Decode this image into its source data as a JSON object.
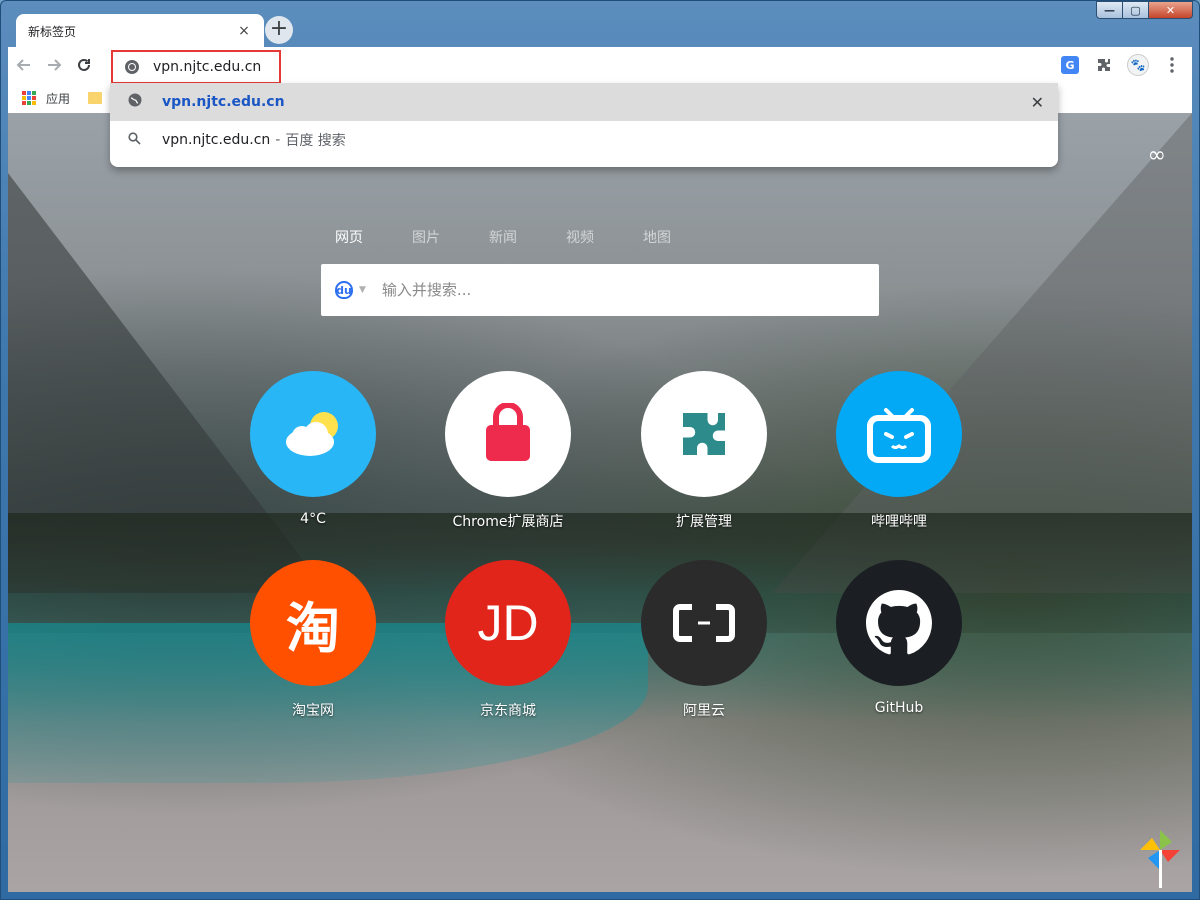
{
  "browser": {
    "tab_title": "新标签页",
    "tab_close": "×",
    "new_tab": "+",
    "omnibox_value": "vpn.njtc.edu.cn",
    "bookmarks": {
      "apps_label": "应用"
    }
  },
  "window_controls": {
    "minimize": "—",
    "maximize": "▢",
    "close": "✕"
  },
  "omnibox_dropdown": {
    "suggestions": [
      {
        "text": "vpn.njtc.edu.cn",
        "icon": "globe-icon"
      },
      {
        "text": "vpn.njtc.edu.cn",
        "separator": "-",
        "description": "百度 搜索",
        "icon": "search-icon"
      }
    ],
    "remove_glyph": "✕"
  },
  "newtab": {
    "search_tabs": [
      "网页",
      "图片",
      "新闻",
      "视频",
      "地图"
    ],
    "active_search_tab": "网页",
    "search_placeholder": "输入并搜索...",
    "engine_icon": "baidu-icon",
    "tiles": [
      {
        "label": "4°C",
        "icon": "weather-icon",
        "color": "#29b6f6"
      },
      {
        "label": "Chrome扩展商店",
        "icon": "bag-icon",
        "color": "#ffffff"
      },
      {
        "label": "扩展管理",
        "icon": "puzzle-icon",
        "color": "#ffffff"
      },
      {
        "label": "哔哩哔哩",
        "icon": "bilibili-icon",
        "color": "#03a9f4"
      },
      {
        "label": "淘宝网",
        "icon": "taobao-icon",
        "color": "#ff5000"
      },
      {
        "label": "京东商城",
        "icon": "jd-icon",
        "color": "#e1251b"
      },
      {
        "label": "阿里云",
        "icon": "aliyun-icon",
        "color": "#2b2b2b"
      },
      {
        "label": "GitHub",
        "icon": "github-icon",
        "color": "#1b1f23"
      }
    ]
  }
}
